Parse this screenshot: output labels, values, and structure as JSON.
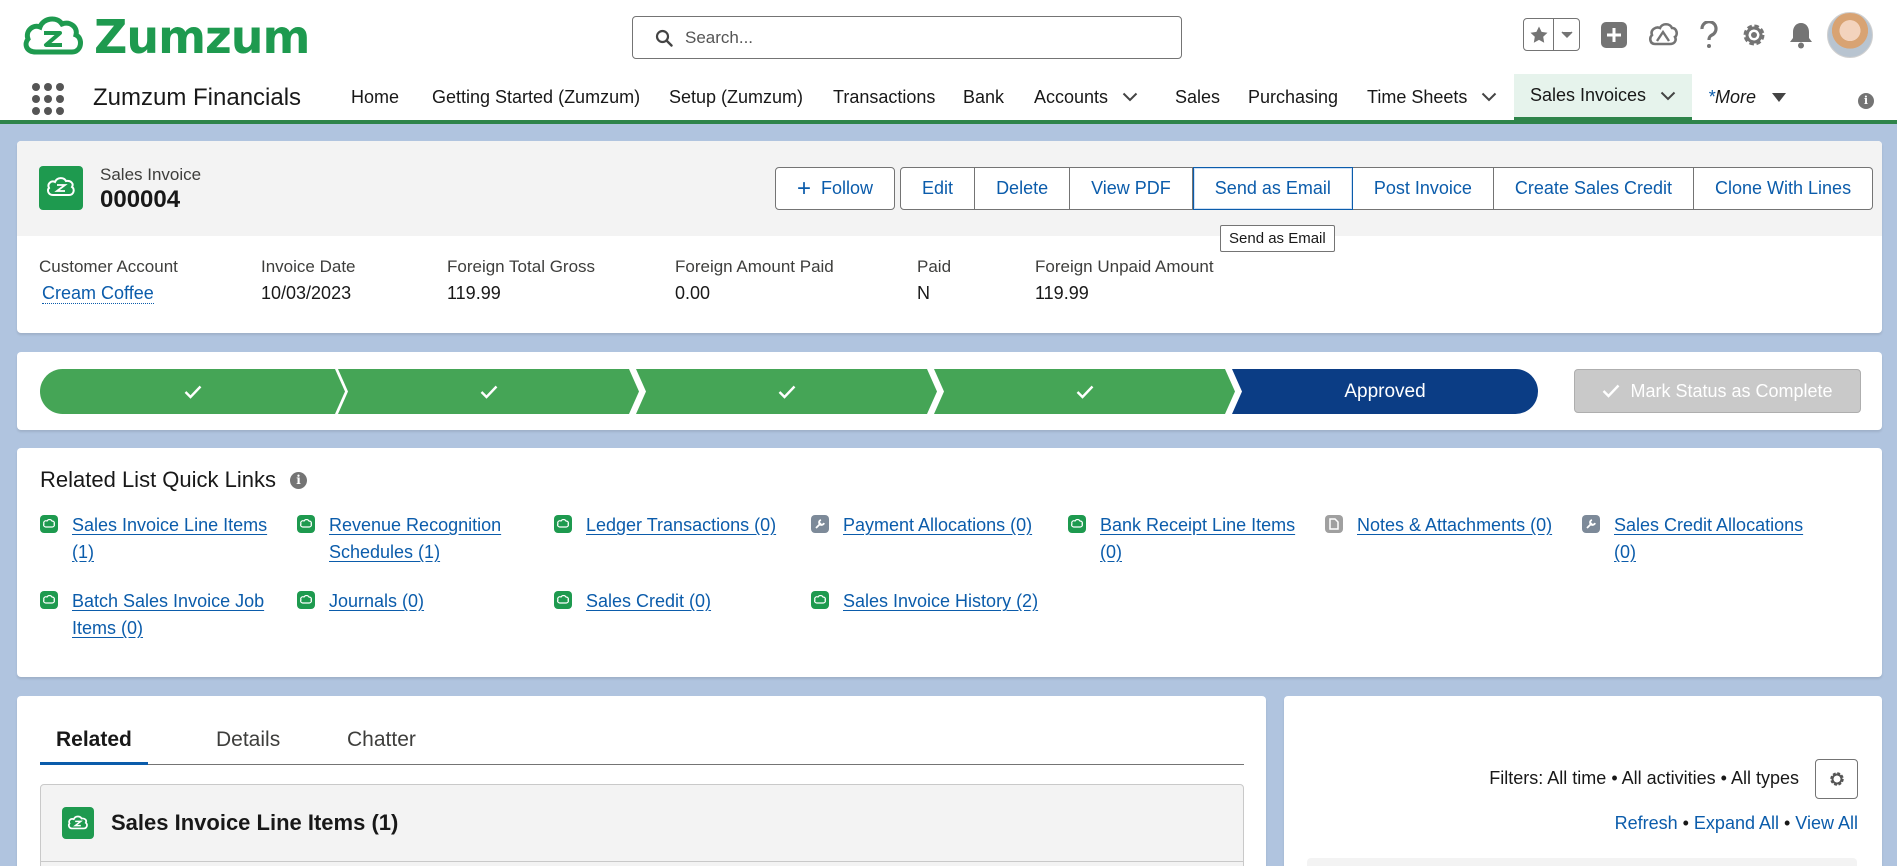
{
  "brand": {
    "name": "Zumzum",
    "color": "#1e9a4f"
  },
  "search": {
    "placeholder": "Search..."
  },
  "header_icons": [
    "favorites-star-icon",
    "chevron-down-icon",
    "global-actions-plus-icon",
    "trailhead-icon",
    "help-icon",
    "setup-gear-icon",
    "notifications-bell-icon"
  ],
  "nav": {
    "app_name": "Zumzum Financials",
    "items": [
      {
        "label": "Home"
      },
      {
        "label": "Getting Started (Zumzum)"
      },
      {
        "label": "Setup (Zumzum)"
      },
      {
        "label": "Transactions"
      },
      {
        "label": "Bank"
      },
      {
        "label": "Accounts"
      },
      {
        "label": "Sales"
      },
      {
        "label": "Purchasing"
      },
      {
        "label": "Time Sheets"
      },
      {
        "label": "Sales Invoices"
      }
    ],
    "more_prefix": "* ",
    "more_label": "More"
  },
  "record": {
    "type_label": "Sales Invoice",
    "name": "000004",
    "actions": {
      "follow": "Follow",
      "edit": "Edit",
      "delete": "Delete",
      "view_pdf": "View PDF",
      "send_email": "Send as Email",
      "post_invoice": "Post Invoice",
      "create_credit": "Create Sales Credit",
      "clone": "Clone With Lines"
    },
    "tooltip": "Send as Email",
    "fields": [
      {
        "label": "Customer Account",
        "value": "Cream Coffee"
      },
      {
        "label": "Invoice Date",
        "value": "10/03/2023"
      },
      {
        "label": "Foreign Total Gross",
        "value": "119.99"
      },
      {
        "label": "Foreign Amount Paid",
        "value": "0.00"
      },
      {
        "label": "Paid",
        "value": "N"
      },
      {
        "label": "Foreign Unpaid Amount",
        "value": "119.99"
      }
    ]
  },
  "path": {
    "completed_steps": 4,
    "current_label": "Approved",
    "mark_button": "Mark Status as Complete",
    "colors": {
      "done": "#45a556",
      "current": "#0b3d85"
    }
  },
  "quick_links": {
    "title": "Related List Quick Links",
    "links": [
      {
        "label": "Sales Invoice Line Items (1)",
        "icon": "zumzum-cloud-icon"
      },
      {
        "label": "Revenue Recognition Schedules (1)",
        "icon": "zumzum-cloud-icon"
      },
      {
        "label": "Ledger Transactions (0)",
        "icon": "zumzum-cloud-icon"
      },
      {
        "label": "Payment Allocations (0)",
        "icon": "wrench-icon"
      },
      {
        "label": "Bank Receipt Line Items (0)",
        "icon": "zumzum-cloud-icon"
      },
      {
        "label": "Notes & Attachments (0)",
        "icon": "file-icon"
      },
      {
        "label": "Sales Credit Allocations (0)",
        "icon": "wrench-icon"
      },
      {
        "label": "Batch Sales Invoice Job Items (0)",
        "icon": "zumzum-cloud-icon"
      },
      {
        "label": "Journals (0)",
        "icon": "zumzum-cloud-icon"
      },
      {
        "label": "Sales Credit (0)",
        "icon": "zumzum-cloud-icon"
      },
      {
        "label": "Sales Invoice History (2)",
        "icon": "zumzum-cloud-icon"
      }
    ]
  },
  "tabs": [
    {
      "label": "Related"
    },
    {
      "label": "Details"
    },
    {
      "label": "Chatter"
    }
  ],
  "related_list": {
    "title": "Sales Invoice Line Items (1)"
  },
  "activity": {
    "filters": "Filters: All time • All activities • All types",
    "refresh": "Refresh",
    "expand_all": "Expand All",
    "view_all": "View All",
    "separator": " • "
  }
}
